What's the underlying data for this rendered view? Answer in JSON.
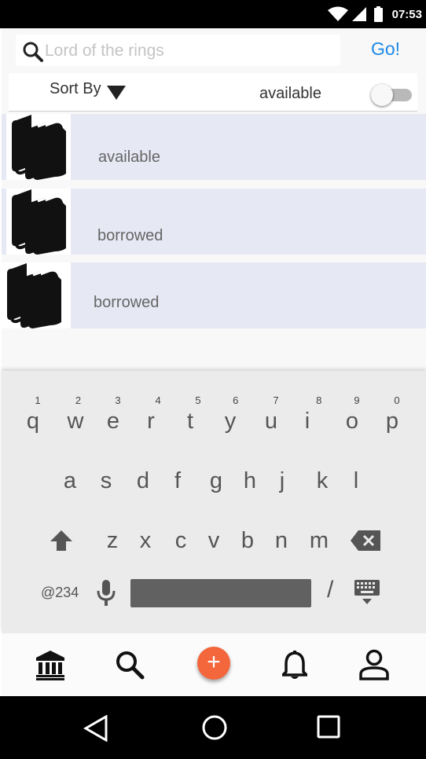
{
  "status_bar": {
    "time": "07:53",
    "icons": [
      "wifi-icon",
      "cell-signal-icon",
      "battery-icon"
    ]
  },
  "search": {
    "placeholder": "Lord of the rings",
    "go_label": "Go!"
  },
  "filter_bar": {
    "sort_label": "Sort By",
    "toggle_label": "available",
    "toggle_on": false
  },
  "books": [
    {
      "status": "available",
      "icon": "books-icon"
    },
    {
      "status": "borrowed",
      "icon": "books-icon"
    },
    {
      "status": "borrowed",
      "icon": "books-icon"
    }
  ],
  "keyboard": {
    "row1": [
      {
        "key": "q",
        "hint": "1"
      },
      {
        "key": "w",
        "hint": "2"
      },
      {
        "key": "e",
        "hint": "3"
      },
      {
        "key": "r",
        "hint": "4"
      },
      {
        "key": "t",
        "hint": "5"
      },
      {
        "key": "y",
        "hint": "6"
      },
      {
        "key": "u",
        "hint": "7"
      },
      {
        "key": "i",
        "hint": "8"
      },
      {
        "key": "o",
        "hint": "9"
      },
      {
        "key": "p",
        "hint": "0"
      }
    ],
    "row2": [
      "a",
      "s",
      "d",
      "f",
      "g",
      "h",
      "j",
      "k",
      "l"
    ],
    "row3": [
      "z",
      "x",
      "c",
      "v",
      "b",
      "n",
      "m"
    ],
    "symbols_label": "@234",
    "slash": "/"
  },
  "bottom_nav": [
    "library-icon",
    "search-icon",
    "add-icon",
    "bell-icon",
    "person-icon"
  ],
  "fab_label": "+",
  "colors": {
    "accent": "#1e88e5",
    "fab": "#f4663c",
    "row_bg": "#e6e8f4"
  }
}
